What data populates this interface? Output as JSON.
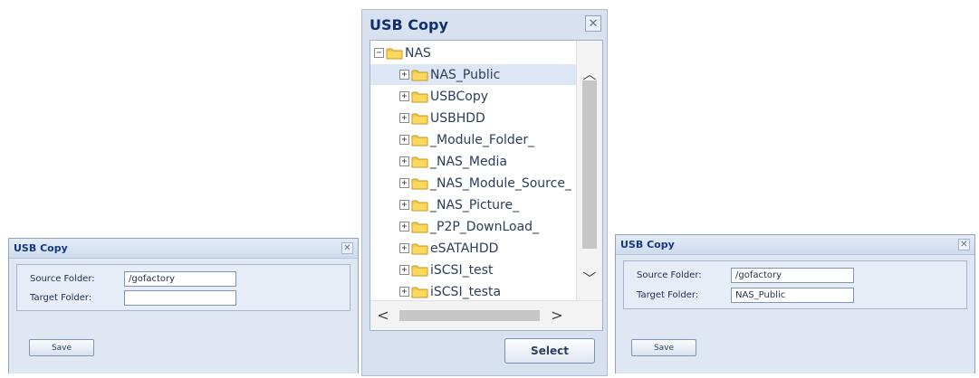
{
  "left_dialog": {
    "title": "USB Copy",
    "source_label": "Source Folder:",
    "source_value": "/gofactory",
    "target_label": "Target Folder:",
    "target_value": "",
    "save_label": "Save",
    "close_glyph": "✕"
  },
  "middle_dialog": {
    "title": "USB Copy",
    "close_glyph": "✕",
    "select_label": "Select",
    "tree": {
      "root": "NAS",
      "children": [
        "NAS_Public",
        "USBCopy",
        "USBHDD",
        "_Module_Folder_",
        "_NAS_Media",
        "_NAS_Module_Source_",
        "_NAS_Picture_",
        "_P2P_DownLoad_",
        "eSATAHDD",
        "iSCSI_test",
        "iSCSI_testa"
      ],
      "selected": "NAS_Public"
    }
  },
  "right_dialog": {
    "title": "USB Copy",
    "source_label": "Source Folder:",
    "source_value": "/gofactory",
    "target_label": "Target Folder:",
    "target_value": "NAS_Public",
    "save_label": "Save",
    "close_glyph": "✕"
  },
  "colors": {
    "title_text": "#0f2f6e",
    "dialog_bg": "#dfe7f3",
    "folder_yellow": "#f5c842",
    "selection": "#dde6f5"
  },
  "icons": {
    "folder": "folder-icon",
    "expand": "plus-box-icon",
    "collapse": "minus-box-icon",
    "close": "close-icon"
  }
}
